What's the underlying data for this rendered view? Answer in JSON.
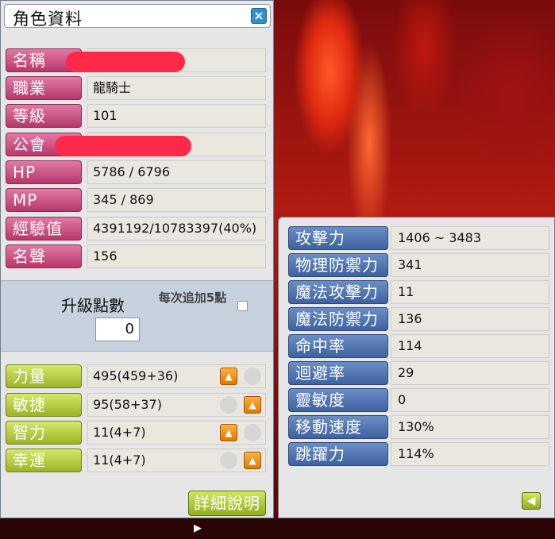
{
  "window": {
    "title": "角色資料",
    "close_icon": "×"
  },
  "profile": [
    {
      "label": "名稱",
      "value": ""
    },
    {
      "label": "職業",
      "value": "龍騎士"
    },
    {
      "label": "等級",
      "value": "101"
    },
    {
      "label": "公會",
      "value": ""
    },
    {
      "label": "HP",
      "value": "5786 / 6796"
    },
    {
      "label": "MP",
      "value": "345 / 869"
    },
    {
      "label": "經驗值",
      "value": "4391192/10783397(40%)"
    },
    {
      "label": "名聲",
      "value": "156"
    }
  ],
  "level_points": {
    "label": "升級點數",
    "value": "0",
    "auto_label": "每次追加5點",
    "auto_checked": false
  },
  "stats": [
    {
      "label": "力量",
      "value": "495(459+36)"
    },
    {
      "label": "敏捷",
      "value": "95(58+37)"
    },
    {
      "label": "智力",
      "value": "11(4+7)"
    },
    {
      "label": "幸運",
      "value": "11(4+7)"
    }
  ],
  "up_icon": "▲",
  "detail_button": "詳細說明",
  "detail_arrow": "▸",
  "back_icon": "◀",
  "details": [
    {
      "label": "攻擊力",
      "value": "1406 ~ 3483"
    },
    {
      "label": "物理防禦力",
      "value": "341"
    },
    {
      "label": "魔法攻擊力",
      "value": "11"
    },
    {
      "label": "魔法防禦力",
      "value": "136"
    },
    {
      "label": "命中率",
      "value": "114"
    },
    {
      "label": "迴避率",
      "value": "29"
    },
    {
      "label": "靈敏度",
      "value": "0"
    },
    {
      "label": "移動速度",
      "value": "130%"
    },
    {
      "label": "跳躍力",
      "value": "114%"
    }
  ],
  "colors": {
    "pink_label": "#c44a7c",
    "green_label": "#a6bd30",
    "blue_label": "#4f72ae",
    "redaction": "#ff2a4a",
    "upgrade_button": "#f08c10"
  }
}
